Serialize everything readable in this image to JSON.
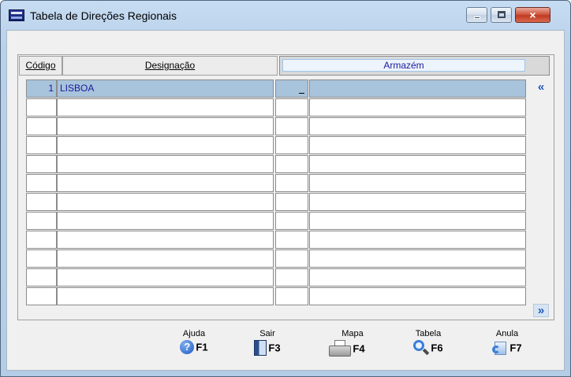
{
  "window": {
    "title": "Tabela de Direções Regionais",
    "close_glyph": "×"
  },
  "columns": {
    "codigo": "Código",
    "designacao": "Designação",
    "armazem": "Armazém"
  },
  "rows": [
    {
      "codigo": "1",
      "designacao": "LISBOA",
      "col3": "",
      "armazem": ""
    },
    {
      "codigo": "",
      "designacao": "",
      "col3": "",
      "armazem": ""
    },
    {
      "codigo": "",
      "designacao": "",
      "col3": "",
      "armazem": ""
    },
    {
      "codigo": "",
      "designacao": "",
      "col3": "",
      "armazem": ""
    },
    {
      "codigo": "",
      "designacao": "",
      "col3": "",
      "armazem": ""
    },
    {
      "codigo": "",
      "designacao": "",
      "col3": "",
      "armazem": ""
    },
    {
      "codigo": "",
      "designacao": "",
      "col3": "",
      "armazem": ""
    },
    {
      "codigo": "",
      "designacao": "",
      "col3": "",
      "armazem": ""
    },
    {
      "codigo": "",
      "designacao": "",
      "col3": "",
      "armazem": ""
    },
    {
      "codigo": "",
      "designacao": "",
      "col3": "",
      "armazem": ""
    },
    {
      "codigo": "",
      "designacao": "",
      "col3": "",
      "armazem": ""
    },
    {
      "codigo": "",
      "designacao": "",
      "col3": "",
      "armazem": ""
    }
  ],
  "scroll": {
    "up_glyph": "«",
    "down_glyph": "»"
  },
  "function_keys": {
    "ajuda": {
      "label": "Ajuda",
      "key": "F1",
      "icon": "help-icon"
    },
    "sair": {
      "label": "Sair",
      "key": "F3",
      "icon": "exit-icon"
    },
    "mapa": {
      "label": "Mapa",
      "key": "F4",
      "icon": "printer-icon"
    },
    "tabela": {
      "label": "Tabela",
      "key": "F6",
      "icon": "magnifier-icon"
    },
    "anula": {
      "label": "Anula",
      "key": "F7",
      "icon": "undo-icon"
    }
  },
  "colors": {
    "selected_row": "#a8c3dc",
    "selected_text": "#1a1a9a",
    "accent": "#1e58b4"
  }
}
